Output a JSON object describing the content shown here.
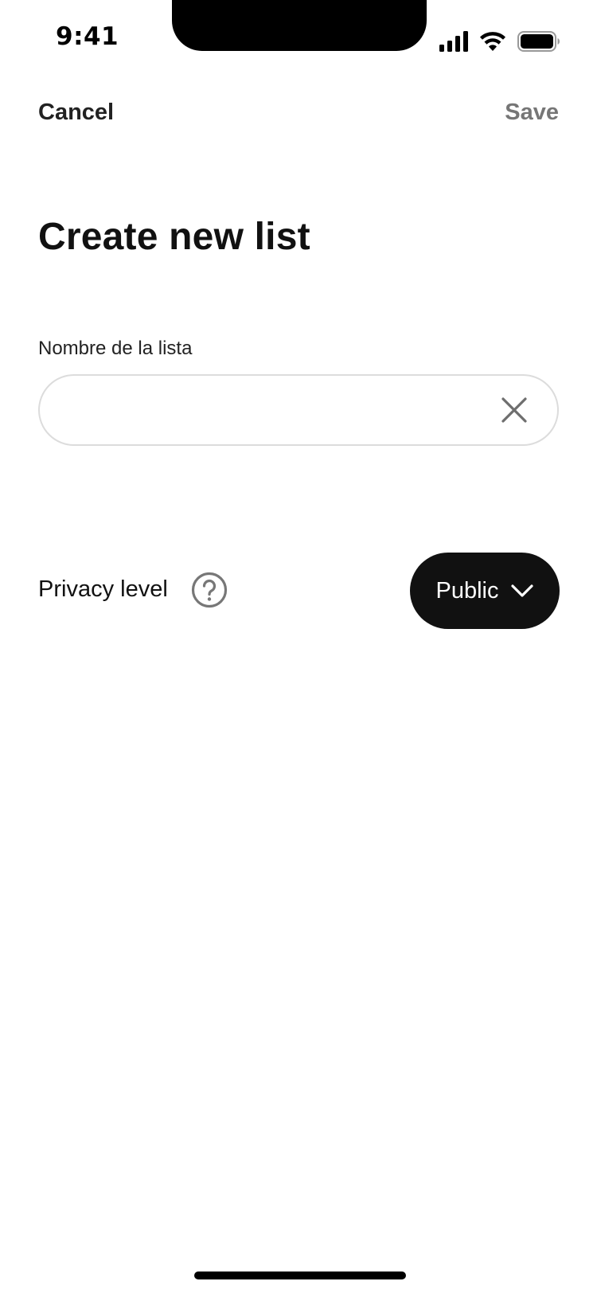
{
  "status_bar": {
    "time": "9:41"
  },
  "nav": {
    "cancel_label": "Cancel",
    "save_label": "Save"
  },
  "title": "Create new list",
  "list_name_field": {
    "label": "Nombre de la lista",
    "value": "",
    "placeholder": ""
  },
  "privacy": {
    "label": "Privacy level",
    "selected": "Public"
  },
  "icons": {
    "help": "question-circle-icon",
    "clear": "close-icon",
    "dropdown": "chevron-down-icon"
  },
  "colors": {
    "primary_button": "#111111",
    "disabled_text": "#767676",
    "field_border": "#dcdcdc"
  }
}
